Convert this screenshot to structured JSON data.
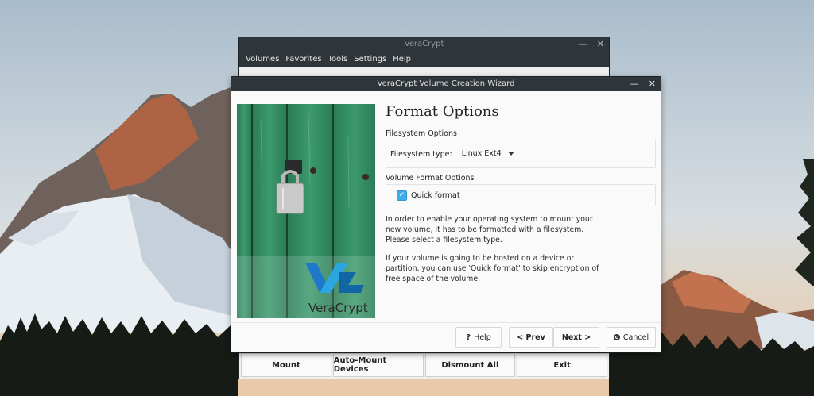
{
  "main_window": {
    "title": "VeraCrypt",
    "menu": [
      "Volumes",
      "Favorites",
      "Tools",
      "Settings",
      "Help"
    ],
    "buttons": {
      "mount": "Mount",
      "auto_mount": "Auto-Mount Devices",
      "dismount_all": "Dismount All",
      "exit": "Exit"
    }
  },
  "wizard": {
    "title": "VeraCrypt Volume Creation Wizard",
    "heading": "Format Options",
    "filesystem_group_label": "Filesystem Options",
    "filesystem_type_label": "Filesystem type:",
    "filesystem_type_value": "Linux Ext4",
    "volume_format_group_label": "Volume Format Options",
    "quick_format_label": "Quick format",
    "quick_format_checked": true,
    "para1": "In order to enable your operating system to mount your new volume, it has to be formatted with a filesystem. Please select a filesystem type.",
    "para2": "If your volume is going to be hosted on a device or partition, you can use 'Quick format' to skip encryption of free space of the volume.",
    "brand_text": "VeraCrypt",
    "buttons": {
      "help": "Help",
      "prev": "< Prev",
      "next": "Next >",
      "cancel": "Cancel"
    }
  },
  "colors": {
    "titlebar": "#2f3539",
    "accent": "#3daee9",
    "door_green": "#2e8a62",
    "logo_blue": "#1f79c8"
  },
  "icons": [
    "minimize-icon",
    "close-icon",
    "help-icon",
    "cancel-icon",
    "checkmark-icon",
    "chevron-down-icon",
    "padlock-icon"
  ]
}
